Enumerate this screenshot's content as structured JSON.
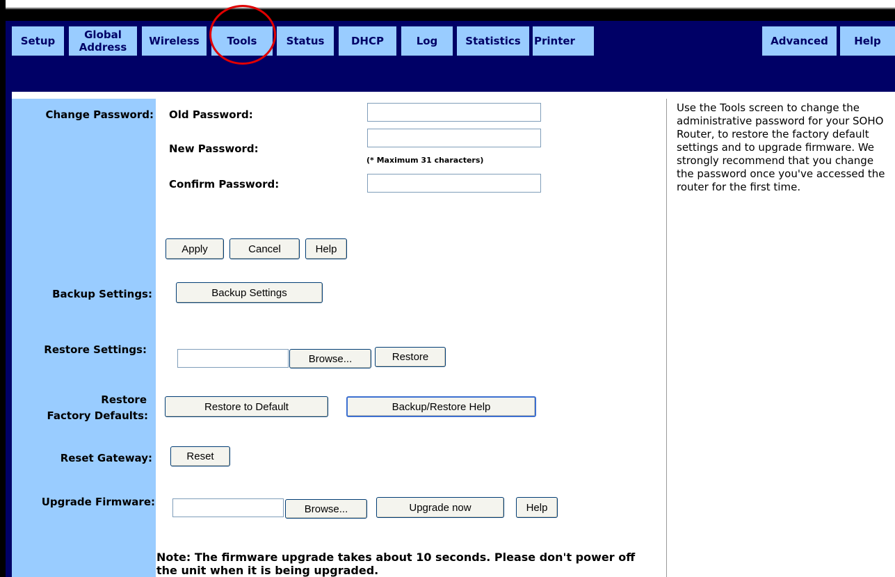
{
  "nav": {
    "tabs": [
      {
        "label": "Setup"
      },
      {
        "label": "Global\nAddress"
      },
      {
        "label": "Wireless"
      },
      {
        "label": "Tools"
      },
      {
        "label": "Status"
      },
      {
        "label": "DHCP"
      },
      {
        "label": "Log"
      },
      {
        "label": "Statistics"
      },
      {
        "label": "Printer"
      }
    ],
    "right_tabs": [
      {
        "label": "Advanced"
      },
      {
        "label": "Help"
      }
    ]
  },
  "change_password": {
    "section_label": "Change Password:",
    "old_label": "Old Password:",
    "new_label": "New Password:",
    "max_note": "(* Maximum 31 characters)",
    "confirm_label": "Confirm Password:",
    "old_value": "",
    "new_value": "",
    "confirm_value": "",
    "apply": "Apply",
    "cancel": "Cancel",
    "help": "Help"
  },
  "backup": {
    "section_label": "Backup Settings:",
    "button": "Backup Settings"
  },
  "restore": {
    "section_label": "Restore Settings:",
    "file_value": "",
    "browse": "Browse...",
    "button": "Restore"
  },
  "factory": {
    "section_label_1": "Restore",
    "section_label_2": "Factory Defaults:",
    "button": "Restore to Default",
    "help_button": "Backup/Restore Help"
  },
  "reset": {
    "section_label": "Reset Gateway:",
    "button": "Reset"
  },
  "firmware": {
    "section_label": "Upgrade Firmware:",
    "file_value": "",
    "browse": "Browse...",
    "button": "Upgrade now",
    "help": "Help",
    "note": "Note: The firmware upgrade takes about 10 seconds. Please don't power off the unit when it is being upgraded."
  },
  "help_panel": {
    "text": "Use the Tools screen to change the administrative password for your SOHO Router, to restore the factory default settings and to upgrade firmware. We strongly recommend that you change the password once you've accessed the router for the first time."
  },
  "colors": {
    "nav_bg": "#000066",
    "tab_bg": "#99ccff",
    "highlight_circle": "#e00000"
  }
}
